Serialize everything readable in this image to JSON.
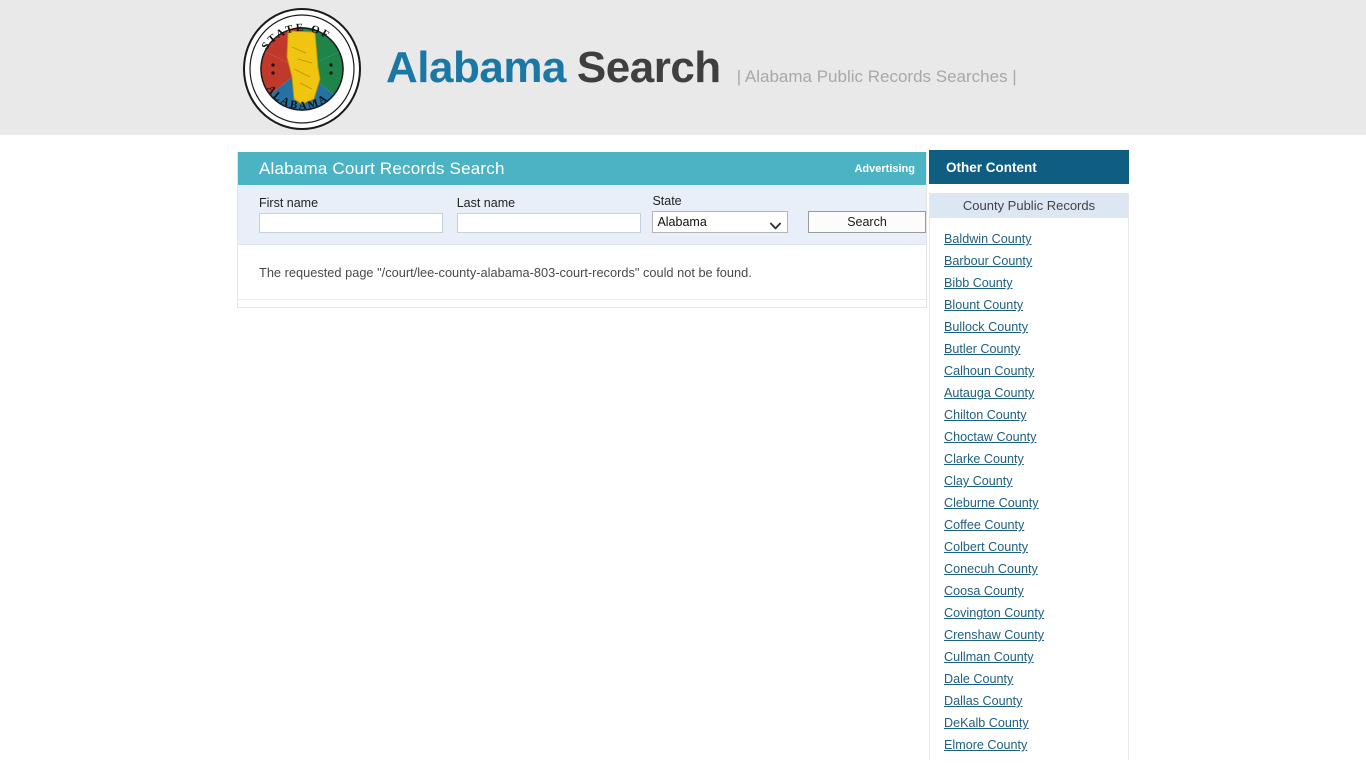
{
  "masthead": {
    "seal": {
      "icon": "alabama-state-seal",
      "top_text": "STATE OF",
      "bottom_text": "ALABAMA"
    },
    "title_primary": "Alabama",
    "title_secondary": "Search",
    "tagline": "| Alabama Public Records Searches |"
  },
  "main": {
    "panel_title": "Alabama Court Records Search",
    "advertising_label": "Advertising",
    "form": {
      "first_name_label": "First name",
      "first_name_value": "",
      "first_name_placeholder": "",
      "last_name_label": "Last name",
      "last_name_value": "",
      "last_name_placeholder": "",
      "state_label": "State",
      "state_selected": "Alabama",
      "state_options": [
        "Alabama"
      ],
      "search_button": "Search"
    },
    "message": "The requested page \"/court/lee-county-alabama-803-court-records\" could not be found."
  },
  "sidebar": {
    "header": "Other Content",
    "subheader": "County Public Records",
    "counties": [
      "Baldwin County",
      "Barbour County",
      "Bibb County",
      "Blount County",
      "Bullock County",
      "Butler County",
      "Calhoun County",
      "Autauga County",
      "Chilton County",
      "Choctaw County",
      "Clarke County",
      "Clay County",
      "Cleburne County",
      "Coffee County",
      "Colbert County",
      "Conecuh County",
      "Coosa County",
      "Covington County",
      "Crenshaw County",
      "Cullman County",
      "Dale County",
      "Dallas County",
      "DeKalb County",
      "Elmore County"
    ]
  },
  "colors": {
    "masthead_bg": "#e9e9e9",
    "panel_header_teal": "#4cb3c4",
    "sidebar_header_blue": "#0f5d80",
    "form_strip_bg": "#e9eff8",
    "subheader_bg": "#dde7f4",
    "link": "#1f6080",
    "title_primary": "#1b78a4",
    "title_secondary": "#3f3f3f"
  }
}
